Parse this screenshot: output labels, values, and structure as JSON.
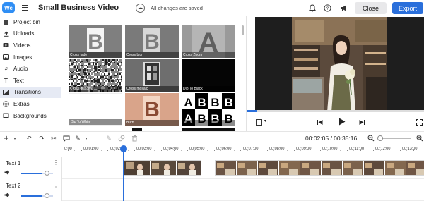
{
  "app": {
    "logo_text": "We",
    "title": "Small Business Video",
    "save_status": "All changes are saved"
  },
  "header": {
    "close_label": "Close",
    "export_label": "Export",
    "icons": [
      "bell-icon",
      "help-icon",
      "megaphone-icon"
    ]
  },
  "sidebar": {
    "items": [
      {
        "label": "Project bin",
        "icon": "project-bin-icon"
      },
      {
        "label": "Uploads",
        "icon": "upload-icon"
      },
      {
        "label": "Videos",
        "icon": "video-icon"
      },
      {
        "label": "Images",
        "icon": "image-icon"
      },
      {
        "label": "Audio",
        "icon": "music-icon"
      },
      {
        "label": "Text",
        "icon": "text-icon"
      },
      {
        "label": "Transitions",
        "icon": "transitions-icon",
        "active": true
      },
      {
        "label": "Extras",
        "icon": "extras-icon"
      },
      {
        "label": "Backgrounds",
        "icon": "backgrounds-icon"
      }
    ]
  },
  "transitions": {
    "items": [
      {
        "label": "Cross fade"
      },
      {
        "label": "Cross blur"
      },
      {
        "label": "Cross Zoom"
      },
      {
        "label": "Cross dissolve"
      },
      {
        "label": "Cross mosaic"
      },
      {
        "label": "Dip To Black"
      },
      {
        "label": "Dip To White"
      },
      {
        "label": "Burn"
      },
      {
        "label": ""
      }
    ]
  },
  "preview": {
    "progress": 0.06
  },
  "toolbar": {
    "time_current": "00:02:05",
    "time_total": "00:35:16",
    "time_display": "00:02:05 / 00:35:16"
  },
  "ruler": {
    "labels": [
      "0:00",
      "00:01:00",
      "00:02:00",
      "00:03:00",
      "00:04:00",
      "00:05:00",
      "00:06:00",
      "00:07:00",
      "00:08:00",
      "00:09:00",
      "00:10:00",
      "00:11:00",
      "00:12:00",
      "00:13:00"
    ]
  },
  "tracks": [
    {
      "name": "Text 1"
    },
    {
      "name": "Text 2"
    }
  ],
  "colors": {
    "accent": "#2a6fdb",
    "logo": "#2f8ef4",
    "active_sidebar": "#e6eaf4"
  }
}
